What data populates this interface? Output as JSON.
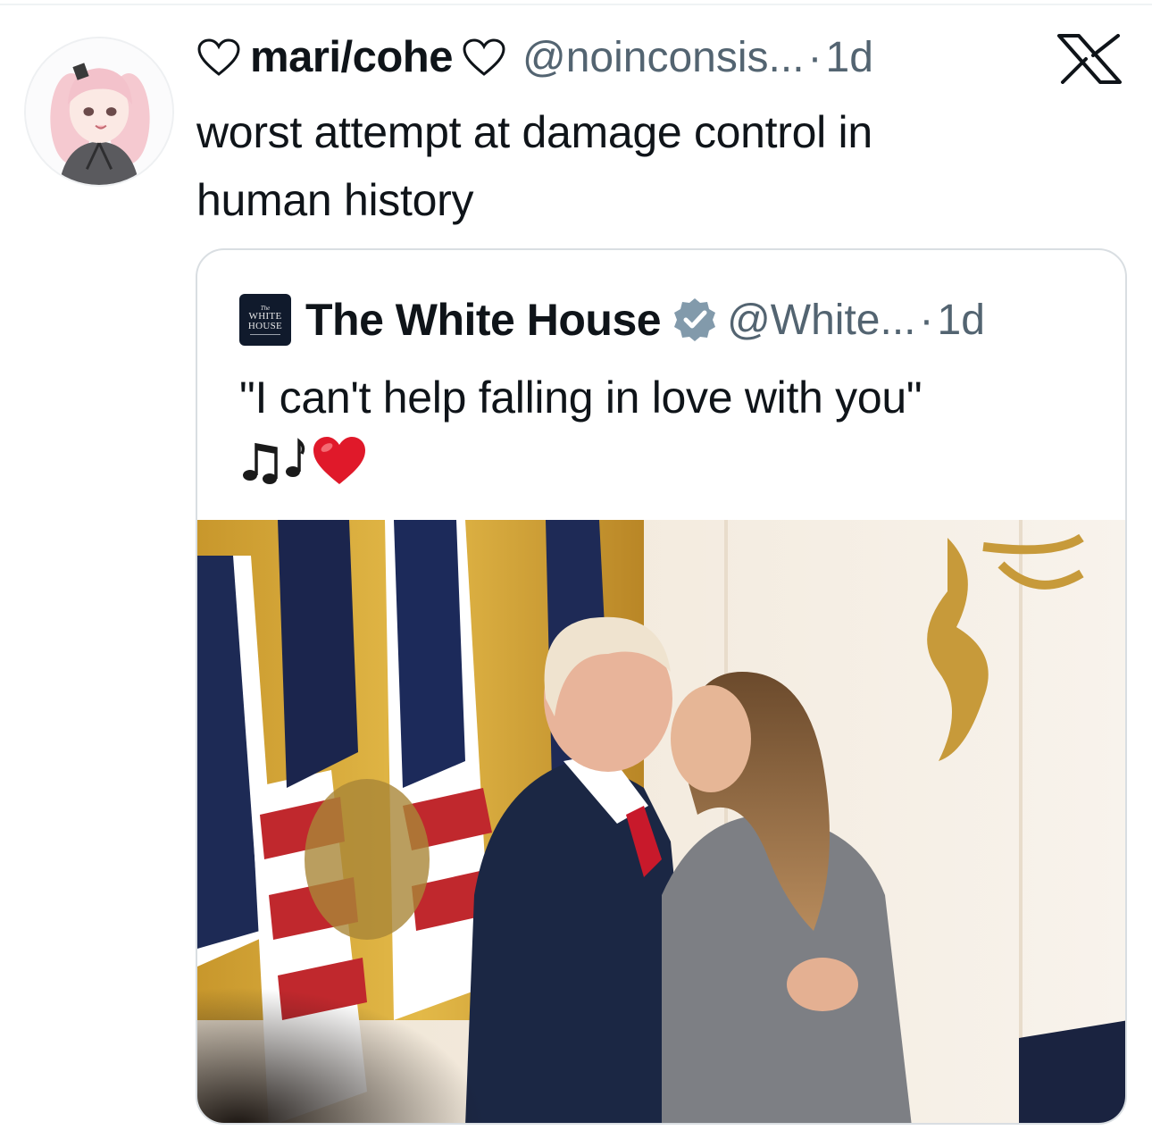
{
  "tweet": {
    "display_name": "mari/cohe",
    "handle": "@noinconsis...",
    "separator": "·",
    "time": "1d",
    "text_line1": "worst attempt at damage control in",
    "text_line2": "human history",
    "platform_logo_icon": "x-logo-icon",
    "name_decoration_icon": "heart-outline-icon"
  },
  "quoted_tweet": {
    "logo_line1": "The",
    "logo_line2": "WHITE",
    "logo_line3": "HOUSE",
    "display_name": "The White House",
    "verified_icon": "verified-badge-icon",
    "handle": "@White...",
    "separator": "·",
    "time": "1d",
    "text": "\"I can't help falling in love with you\"",
    "emoji": [
      "musical-notes-icon",
      "red-heart-icon"
    ],
    "photo": "photo of a man kissing a woman on the cheek in front of American flags"
  },
  "colors": {
    "text_primary": "#0f1419",
    "text_secondary": "#536471",
    "border": "#d9dee2",
    "verified_badge": "#829aab",
    "heart_red": "#e0192a"
  }
}
